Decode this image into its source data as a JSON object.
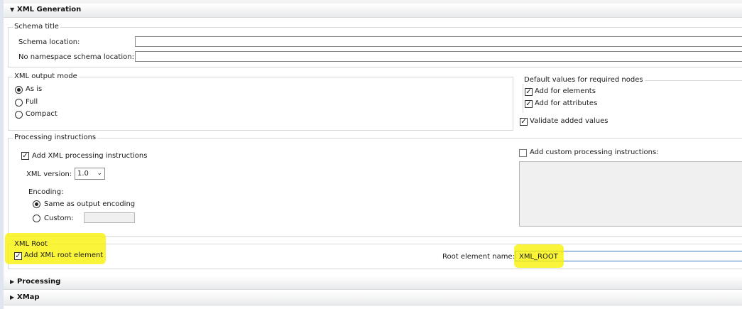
{
  "sections": {
    "xml_generation": "XML Generation",
    "processing": "Processing",
    "xmap": "XMap"
  },
  "schema": {
    "group_title": "Schema title",
    "location_label": "Schema location:",
    "location_value": "",
    "nons_label": "No namespace schema location:",
    "nons_value": ""
  },
  "output_mode": {
    "group_title": "XML output mode",
    "options": [
      "As is",
      "Full",
      "Compact"
    ],
    "selected": "As is"
  },
  "defaults": {
    "title": "Default values for required nodes",
    "add_elements": "Add for elements",
    "add_attributes": "Add for attributes",
    "validate": "Validate added values"
  },
  "processing_instructions": {
    "group_title": "Processing instructions",
    "add_pi": "Add XML processing instructions",
    "version_label": "XML version:",
    "version_value": "1.0",
    "encoding_label": "Encoding:",
    "same_as_output": "Same as output encoding",
    "custom_label": "Custom:",
    "custom_value": "",
    "add_custom_pi": "Add custom processing instructions:"
  },
  "xml_root": {
    "group_title": "XML Root",
    "add_root": "Add XML root element",
    "root_name_label": "Root element name:",
    "root_name_value": "XML_ROOT"
  },
  "colors": {
    "highlight": "#f8f200",
    "header_bg": "#e9eaec"
  }
}
